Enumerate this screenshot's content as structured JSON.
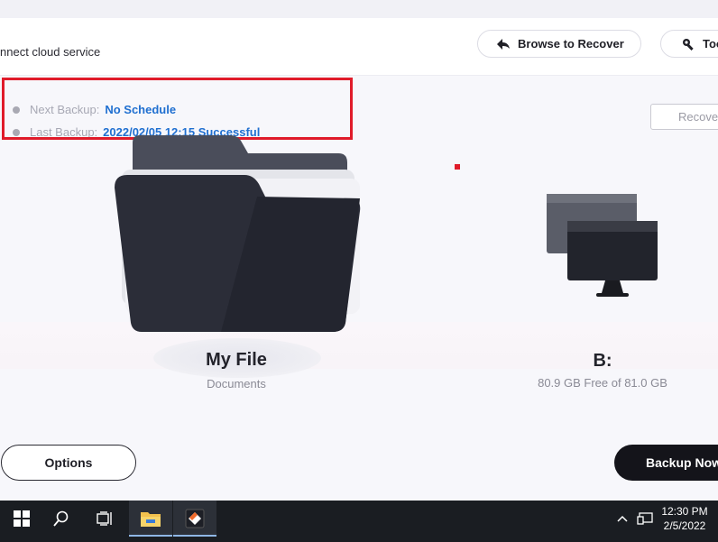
{
  "header": {
    "cloud_text": "nnect cloud service",
    "browse_label": "Browse to Recover",
    "tools_label": "Too"
  },
  "status": {
    "next_label": "Next Backup:",
    "next_value": "No Schedule",
    "last_label": "Last Backup:",
    "last_value": "2022/02/05 12:15 Successful"
  },
  "recover_label": "Recove",
  "source": {
    "title": "My File",
    "subtitle": "Documents"
  },
  "target": {
    "title": "B:",
    "subtitle": "80.9 GB Free of 81.0 GB"
  },
  "buttons": {
    "options": "Options",
    "backup_now": "Backup Now"
  },
  "taskbar": {
    "time": "12:30 PM",
    "date": "2/5/2022",
    "icons": [
      "windows-start-icon",
      "search-icon",
      "task-view-icon",
      "file-explorer-icon",
      "backup-app-icon"
    ]
  },
  "colors": {
    "accent_blue": "#1f6fd0",
    "highlight_red": "#e01b2a",
    "dark_button": "#14141a"
  }
}
